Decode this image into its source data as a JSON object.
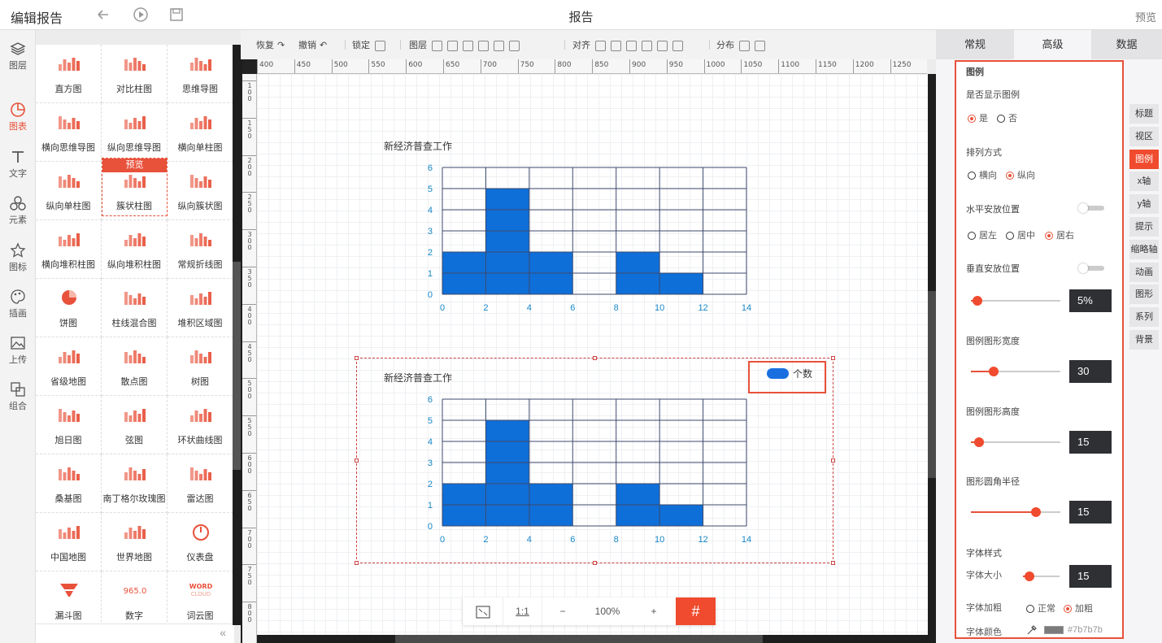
{
  "topbar": {
    "app_title": "编辑报告",
    "doc_title": "报告",
    "preview": "预览"
  },
  "leftnav": [
    {
      "label": "图层",
      "icon": "layers-icon"
    },
    {
      "label": "图表",
      "icon": "chart-icon",
      "active": true
    },
    {
      "label": "文字",
      "icon": "text-icon"
    },
    {
      "label": "元素",
      "icon": "elements-icon"
    },
    {
      "label": "图标",
      "icon": "star-icon"
    },
    {
      "label": "插画",
      "icon": "palette-icon"
    },
    {
      "label": "上传",
      "icon": "upload-image-icon"
    },
    {
      "label": "组合",
      "icon": "group-icon"
    }
  ],
  "palette": {
    "items": [
      "直方图",
      "对比柱图",
      "思维导图",
      "横向思维导图",
      "纵向思维导图",
      "横向单柱图",
      "纵向单柱图",
      "簇状柱图",
      "纵向簇状图",
      "横向堆积柱图",
      "纵向堆积柱图",
      "常规折线图",
      "饼图",
      "柱线混合图",
      "堆积区域图",
      "省级地图",
      "散点图",
      "树图",
      "旭日图",
      "弦图",
      "环状曲线图",
      "桑基图",
      "南丁格尔玫瑰图",
      "雷达图",
      "中国地图",
      "世界地图",
      "仪表盘",
      "漏斗图",
      "数字",
      "词云图"
    ],
    "selected_tag": "预览",
    "number_glyph": "965.0",
    "word_glyph": "WORD CLOUD"
  },
  "editor_toolbar": {
    "redo": "恢复",
    "undo": "撤销",
    "lock": "锁定",
    "layer": "图层",
    "align": "对齐",
    "distribute": "分布"
  },
  "ruler": {
    "top": [
      "400",
      "450",
      "500",
      "550",
      "600",
      "650",
      "700",
      "750",
      "800",
      "850",
      "900",
      "950",
      "1000",
      "1050",
      "1100",
      "1150",
      "1200",
      "1250"
    ],
    "left": [
      "100",
      "150",
      "200",
      "250",
      "300",
      "350",
      "400",
      "450",
      "500",
      "550",
      "600",
      "650",
      "700",
      "750",
      "800"
    ]
  },
  "charts": {
    "title": "新经济普查工作",
    "legend_label": "个数"
  },
  "chart_data": [
    {
      "type": "bar",
      "title": "新经济普查工作",
      "x": [
        0,
        2,
        4,
        6,
        8,
        10,
        12,
        14
      ],
      "bins": [
        [
          0,
          2
        ],
        [
          2,
          4
        ],
        [
          4,
          6
        ],
        [
          6,
          8
        ],
        [
          8,
          10
        ],
        [
          10,
          12
        ],
        [
          12,
          14
        ]
      ],
      "values": [
        2,
        5,
        2,
        0,
        2,
        1,
        0
      ],
      "ylim": [
        0,
        6
      ],
      "xlim": [
        0,
        14
      ],
      "xticks": [
        "0",
        "2",
        "4",
        "6",
        "8",
        "10",
        "12",
        "14"
      ],
      "yticks": [
        "0",
        "1",
        "2",
        "3",
        "4",
        "5",
        "6"
      ],
      "bar_color": "#0f6fd9",
      "legend": "none"
    },
    {
      "type": "bar",
      "title": "新经济普查工作",
      "x": [
        0,
        2,
        4,
        6,
        8,
        10,
        12,
        14
      ],
      "bins": [
        [
          0,
          2
        ],
        [
          2,
          4
        ],
        [
          4,
          6
        ],
        [
          6,
          8
        ],
        [
          8,
          10
        ],
        [
          10,
          12
        ],
        [
          12,
          14
        ]
      ],
      "values": [
        2,
        5,
        2,
        0,
        2,
        1,
        0
      ],
      "ylim": [
        0,
        6
      ],
      "xlim": [
        0,
        14
      ],
      "xticks": [
        "0",
        "2",
        "4",
        "6",
        "8",
        "10",
        "12",
        "14"
      ],
      "yticks": [
        "0",
        "1",
        "2",
        "3",
        "4",
        "5",
        "6"
      ],
      "bar_color": "#0f6fd9",
      "legend": "top-right",
      "series": [
        {
          "name": "个数",
          "values": [
            2,
            5,
            2,
            0,
            2,
            1,
            0
          ]
        }
      ]
    }
  ],
  "zoom": {
    "ratio_label": "1:1",
    "minus": "−",
    "percent": "100%",
    "plus": "+",
    "grid_icon": "#"
  },
  "right_panel": {
    "tabs": [
      "常规",
      "高级",
      "数据"
    ],
    "active_tab": "高级",
    "section": "图例",
    "show_legend": {
      "label": "是否显示图例",
      "yes": "是",
      "no": "否",
      "value": "是"
    },
    "orient": {
      "label": "排列方式",
      "horizontal": "横向",
      "vertical": "纵向",
      "value": "纵向"
    },
    "h_pos": {
      "label": "水平安放位置",
      "left": "居左",
      "center": "居中",
      "right": "居右",
      "value": "居右",
      "toggle": false
    },
    "v_pos": {
      "label": "垂直安放位置",
      "toggle": false,
      "value": "5%",
      "level": 0.02
    },
    "item_width": {
      "label": "图例图形宽度",
      "value": "30",
      "level": 0.22
    },
    "item_height": {
      "label": "图例图形高度",
      "value": "15",
      "level": 0.04
    },
    "radius": {
      "label": "图形圆角半径",
      "value": "15",
      "level": 0.75
    },
    "font": {
      "label": "字体样式",
      "size_label": "字体大小",
      "size_value": "15",
      "size_level": 0.06,
      "weight_label": "字体加粗",
      "normal": "正常",
      "bold": "加粗",
      "weight_value": "加粗",
      "color_label": "字体颜色",
      "color_value": "#7b7b7b"
    }
  },
  "side_tabs": [
    "标题",
    "视区",
    "图例",
    "x轴",
    "y轴",
    "提示",
    "缩略轴",
    "动画",
    "图形",
    "系列",
    "背景"
  ],
  "active_side_tab": "图例",
  "colors": {
    "accent": "#f04b2e",
    "bar": "#0f6fd9",
    "axis_text": "#1787c6"
  }
}
